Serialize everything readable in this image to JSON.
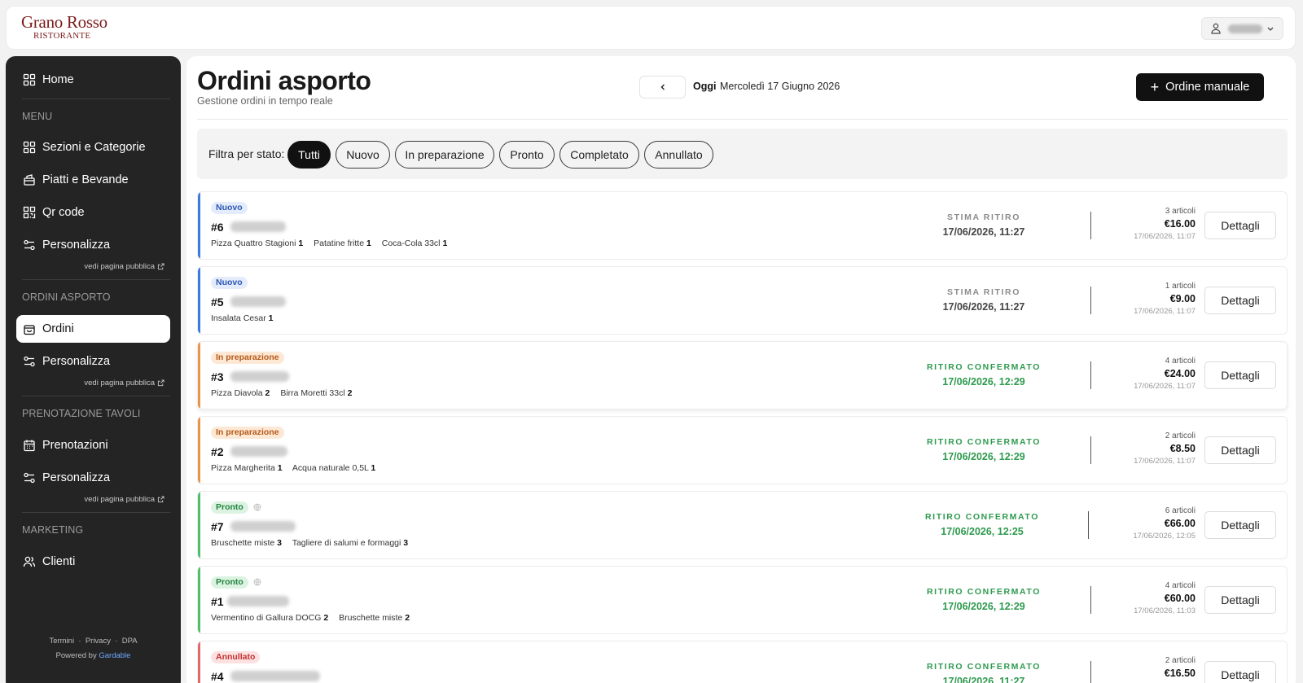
{
  "brand": {
    "name": "Grano Rosso",
    "tagline": "RISTORANTE"
  },
  "sidebar": {
    "home": "Home",
    "sections": [
      {
        "title": "MENU",
        "items": [
          "Sezioni e Categorie",
          "Piatti e Bevande",
          "Qr code",
          "Personalizza"
        ]
      },
      {
        "title": "ORDINI ASPORTO",
        "items": [
          "Ordini",
          "Personalizza"
        ]
      },
      {
        "title": "PRENOTAZIONE TAVOLI",
        "items": [
          "Prenotazioni",
          "Personalizza"
        ]
      },
      {
        "title": "MARKETING",
        "items": [
          "Clienti"
        ]
      }
    ],
    "public_link": "vedi pagina pubblica",
    "footer": {
      "links": [
        "Termini",
        "Privacy",
        "DPA"
      ],
      "separator": "·",
      "powered": "Powered by",
      "provider": "Gardable"
    }
  },
  "page": {
    "title": "Ordini asporto",
    "subtitle": "Gestione ordini in tempo reale",
    "date_label": "Oggi",
    "date": "Mercoledì 17 Giugno 2026",
    "manual_button": "Ordine manuale"
  },
  "filters": {
    "label": "Filtra per stato:",
    "options": [
      "Tutti",
      "Nuovo",
      "In preparazione",
      "Pronto",
      "Completato",
      "Annullato"
    ],
    "selected": "Tutti"
  },
  "colors": {
    "nuovo": "#3d7ae0",
    "preparazione": "#e9944a",
    "pronto": "#4fbf6b",
    "annullato": "#e06a6a"
  },
  "orders": [
    {
      "status": "Nuovo",
      "number": "#6",
      "items": [
        [
          "Pizza Quattro Stagioni",
          "1"
        ],
        [
          "Patatine fritte",
          "1"
        ],
        [
          "Coca-Cola 33cl",
          "1"
        ]
      ],
      "pickup_label": "STIMA RITIRO",
      "pickup_time": "17/06/2026, 11:27",
      "count": "3 articoli",
      "total": "€16.00",
      "created": "17/06/2026, 11:07",
      "action": "Dettagli"
    },
    {
      "status": "Nuovo",
      "number": "#5",
      "items": [
        [
          "Insalata Cesar",
          "1"
        ]
      ],
      "pickup_label": "STIMA RITIRO",
      "pickup_time": "17/06/2026, 11:27",
      "count": "1 articoli",
      "total": "€9.00",
      "created": "17/06/2026, 11:07",
      "action": "Dettagli"
    },
    {
      "status": "In preparazione",
      "number": "#3",
      "items": [
        [
          "Pizza Diavola",
          "2"
        ],
        [
          "Birra Moretti 33cl",
          "2"
        ]
      ],
      "pickup_label": "RITIRO CONFERMATO",
      "pickup_time": "17/06/2026, 12:29",
      "count": "4 articoli",
      "total": "€24.00",
      "created": "17/06/2026, 11:07",
      "action": "Dettagli"
    },
    {
      "status": "In preparazione",
      "number": "#2",
      "items": [
        [
          "Pizza Margherita",
          "1"
        ],
        [
          "Acqua naturale 0,5L",
          "1"
        ]
      ],
      "pickup_label": "RITIRO CONFERMATO",
      "pickup_time": "17/06/2026, 12:29",
      "count": "2 articoli",
      "total": "€8.50",
      "created": "17/06/2026, 11:07",
      "action": "Dettagli"
    },
    {
      "status": "Pronto",
      "number": "#7",
      "items": [
        [
          "Bruschette miste",
          "3"
        ],
        [
          "Tagliere di salumi e formaggi",
          "3"
        ]
      ],
      "pickup_label": "RITIRO CONFERMATO",
      "pickup_time": "17/06/2026, 12:25",
      "count": "6 articoli",
      "total": "€66.00",
      "created": "17/06/2026, 12:05",
      "action": "Dettagli"
    },
    {
      "status": "Pronto",
      "number": "#1",
      "items": [
        [
          "Vermentino di Gallura DOCG",
          "2"
        ],
        [
          "Bruschette miste",
          "2"
        ]
      ],
      "pickup_label": "RITIRO CONFERMATO",
      "pickup_time": "17/06/2026, 12:29",
      "count": "4 articoli",
      "total": "€60.00",
      "created": "17/06/2026, 11:03",
      "action": "Dettagli"
    },
    {
      "status": "Annullato",
      "number": "#4",
      "items": [],
      "pickup_label": "RITIRO CONFERMATO",
      "pickup_time": "17/06/2026, 11:27",
      "count": "2 articoli",
      "total": "€16.50",
      "created": "",
      "action": "Dettagli"
    }
  ]
}
